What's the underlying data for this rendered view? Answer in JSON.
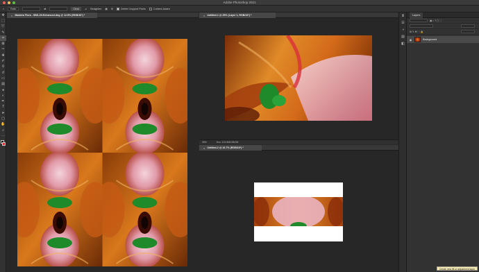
{
  "app": {
    "title": "Adobe Photoshop 2021"
  },
  "colors": {
    "chrome": "#323232",
    "canvas_bg": "#272727",
    "accent_orange": "#e07a1a",
    "leaf_green": "#1f8a2a",
    "petal_pink": "#e9a4b2"
  },
  "options_bar": {
    "ratio": "Ratio",
    "clear": "Clear",
    "straighten": "Straighten",
    "delete_cropped": "Delete Cropped Pixels",
    "content_aware": "Content-Aware"
  },
  "docs": {
    "left": {
      "tab": "Madeira Flora - SBS-29-Enhanced.dng @ 12.5% (RGB/16*) *"
    },
    "top_right": {
      "tab": "Untitled-1 @ 25% (Layer 1, RGB/16*) *",
      "zoom": "25%",
      "doc_info": "Doc: 121.5M/108.0M"
    },
    "bottom_right": {
      "tab": "Untitled-2 @ 16.7% (RGB/16*) *"
    }
  },
  "layers_panel": {
    "tab": "Layers",
    "layer": {
      "name": "Background",
      "icon": "eye-icon"
    }
  },
  "tooltip": "Create new fill or adjustment layer"
}
